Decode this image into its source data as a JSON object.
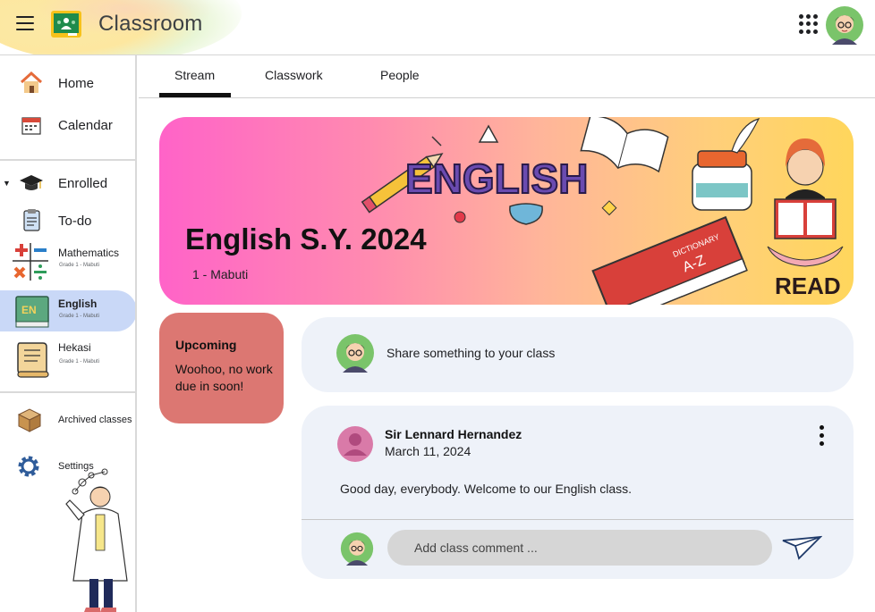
{
  "app": {
    "title": "Classroom"
  },
  "header": {
    "menu_icon": "hamburger-icon",
    "logo_icon": "classroom-logo-icon",
    "apps_icon": "apps-grid-icon",
    "avatar_icon": "user-avatar"
  },
  "sidebar": {
    "home": {
      "label": "Home",
      "icon": "home-icon"
    },
    "calendar": {
      "label": "Calendar",
      "icon": "calendar-icon"
    },
    "enrolled": {
      "label": "Enrolled",
      "icon": "graduation-cap-icon"
    },
    "todo": {
      "label": "To-do",
      "icon": "clipboard-icon"
    },
    "classes": [
      {
        "name": "Mathematics",
        "sub": "Grade 1 - Mabuti",
        "icon": "math-symbols-icon",
        "active": false
      },
      {
        "name": "English",
        "sub": "Grade 1 - Mabuti",
        "icon": "english-book-icon",
        "active": true
      },
      {
        "name": "Hekasi",
        "sub": "Grade 1 - Mabuti",
        "icon": "scroll-icon",
        "active": false
      }
    ],
    "archived": {
      "label": "Archived classes",
      "icon": "archive-box-icon"
    },
    "settings": {
      "label": "Settings",
      "icon": "gear-icon"
    }
  },
  "tabs": [
    {
      "label": "Stream",
      "active": true
    },
    {
      "label": "Classwork",
      "active": false
    },
    {
      "label": "People",
      "active": false
    }
  ],
  "banner": {
    "title": "English S.Y. 2024",
    "subtitle": "1 - Mabuti",
    "art_word": "ENGLISH",
    "book_word": "DICTIONARY",
    "book_letters": "A-Z",
    "read_word": "READ",
    "gradient": [
      "#ff63c8",
      "#ffd65c"
    ]
  },
  "upcoming": {
    "title": "Upcoming",
    "text": "Woohoo, no work due in soon!",
    "color": "#dc7772"
  },
  "share": {
    "text": "Share something to your class"
  },
  "post": {
    "author": "Sir Lennard Hernandez",
    "date": "March 11, 2024",
    "body": "Good day, everybody. Welcome to our English class.",
    "comment_placeholder": "Add class comment ...",
    "more_icon": "more-vert-icon",
    "send_icon": "send-icon"
  },
  "colors": {
    "active_class_bg": "#c9d8f7",
    "card_bg": "#eef2f9"
  }
}
